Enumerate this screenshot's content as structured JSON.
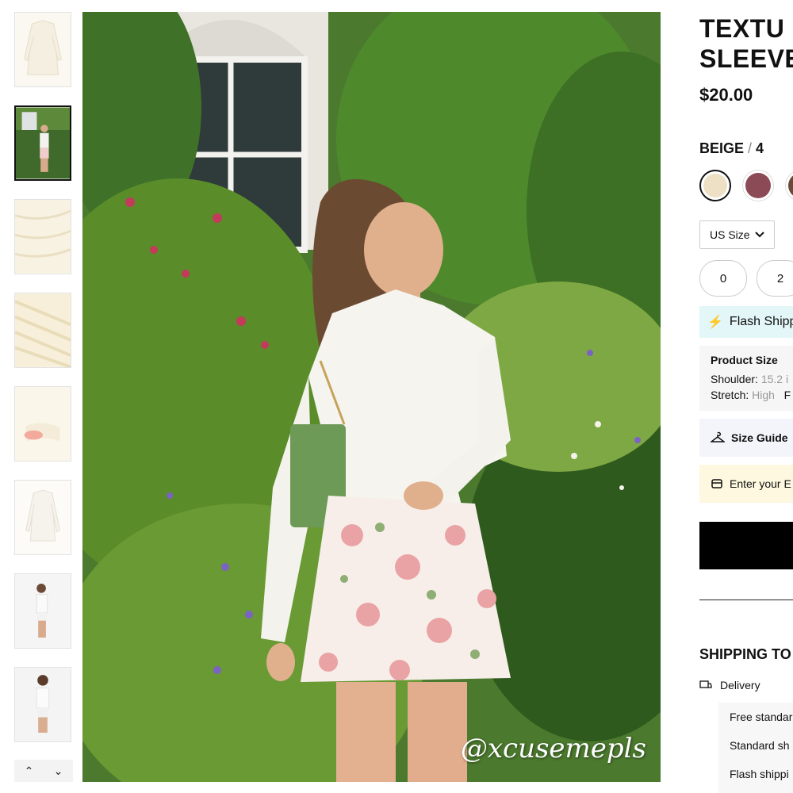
{
  "thumbnails": [
    {
      "name": "thumb-shirt-flat"
    },
    {
      "name": "thumb-model-garden"
    },
    {
      "name": "thumb-fabric-detail-1"
    },
    {
      "name": "thumb-fabric-detail-2"
    },
    {
      "name": "thumb-fabric-cuff"
    },
    {
      "name": "thumb-shirt-front"
    },
    {
      "name": "thumb-model-white-1"
    },
    {
      "name": "thumb-model-white-2"
    }
  ],
  "thumb_nav": {
    "up": "⌃",
    "down": "⌄"
  },
  "main_image": {
    "watermark": "@xcusemepls"
  },
  "product": {
    "title_line1": "TEXTU",
    "title_line2": "SLEEVE",
    "price": "$20.00",
    "color_name": "BEIGE",
    "color_sep": " / ",
    "selected_size": "4"
  },
  "swatches": [
    {
      "name": "beige",
      "color": "#ede0c4",
      "selected": true
    },
    {
      "name": "mauve",
      "color": "#8c4a57",
      "selected": false
    },
    {
      "name": "brown",
      "color": "#6b4a3a",
      "selected": false
    }
  ],
  "size_select": {
    "label": "US Size"
  },
  "sizes": [
    "0",
    "2"
  ],
  "flash": {
    "label": "Flash Shipp"
  },
  "product_size": {
    "heading": "Product Size",
    "shoulder_label": "Shoulder:",
    "shoulder_value": "15.2 i",
    "stretch_label": "Stretch:",
    "stretch_value": "High",
    "stretch_extra": "F"
  },
  "size_guide": {
    "label": "Size Guide"
  },
  "enter": {
    "label": "Enter your E"
  },
  "shipping": {
    "heading": "SHIPPING TO",
    "delivery_label": "Delivery",
    "options": [
      "Free standar",
      "Standard sh",
      "Flash shippi"
    ]
  },
  "colors": {
    "accent": "#1aa7c4",
    "flash_bg": "#e3f6f8",
    "enter_bg": "#fdf8df",
    "guide_bg": "#f4f5fb"
  }
}
